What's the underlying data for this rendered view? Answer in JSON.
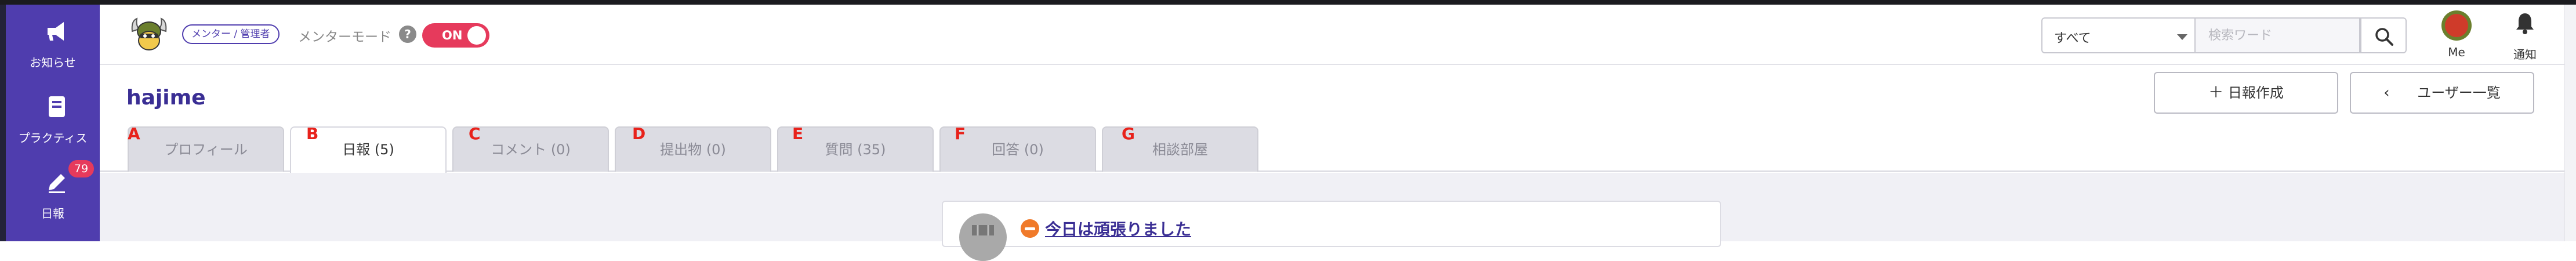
{
  "sidebar": {
    "items": [
      {
        "label": "お知らせ",
        "icon": "megaphone-icon"
      },
      {
        "label": "プラクティス",
        "icon": "book-icon"
      },
      {
        "label": "日報",
        "icon": "pencil-icon",
        "badge": "79"
      }
    ]
  },
  "header": {
    "role_badge": "メンター / 管理者",
    "mentor_mode_label": "メンターモード",
    "mentor_mode_help": "?",
    "mentor_mode_toggle": "ON",
    "search": {
      "filter_value": "すべて",
      "placeholder": "検索ワード"
    },
    "me_label": "Me",
    "notifications_label": "通知"
  },
  "user": {
    "name": "hajime"
  },
  "actions": {
    "create_report": "日報作成",
    "create_report_icon": "＋",
    "user_list": "ユーザー一覧",
    "user_list_icon": "‹"
  },
  "tabs": [
    {
      "letter": "A",
      "label": "プロフィール"
    },
    {
      "letter": "B",
      "label": "日報 (5)"
    },
    {
      "letter": "C",
      "label": "コメント (0)"
    },
    {
      "letter": "D",
      "label": "提出物 (0)"
    },
    {
      "letter": "E",
      "label": "質問 (35)"
    },
    {
      "letter": "F",
      "label": "回答 (0)"
    },
    {
      "letter": "G",
      "label": "相談部屋"
    }
  ],
  "active_tab": "日報 (5)",
  "report": {
    "title": "今日は頑張りました"
  },
  "colors": {
    "brand": "#4f3dae",
    "accent": "#e63a5c",
    "link": "#3a2e94"
  }
}
